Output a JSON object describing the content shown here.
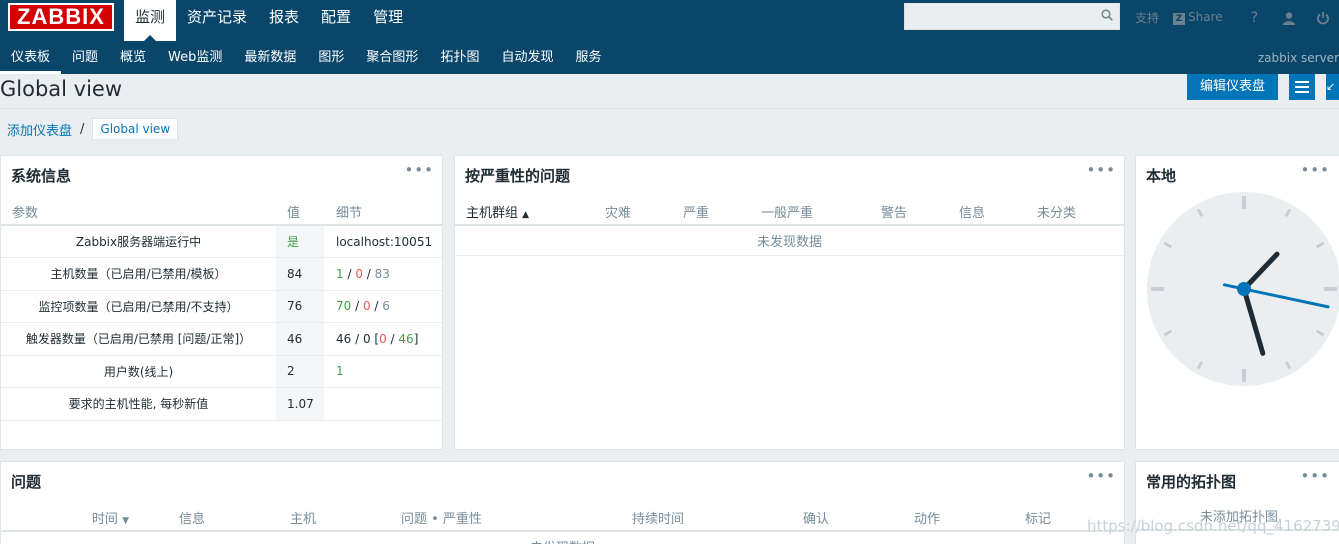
{
  "header": {
    "logo": "ZABBIX",
    "main_menu": [
      {
        "label": "监测",
        "active": true
      },
      {
        "label": "资产记录",
        "active": false
      },
      {
        "label": "报表",
        "active": false
      },
      {
        "label": "配置",
        "active": false
      },
      {
        "label": "管理",
        "active": false
      }
    ],
    "search": {
      "value": "",
      "placeholder": ""
    },
    "support_label": "支持",
    "share_label": "Share",
    "help_icon": "question-icon",
    "user_icon": "user-icon",
    "logout_icon": "power-icon"
  },
  "submenu": {
    "items": [
      {
        "label": "仪表板",
        "active": true
      },
      {
        "label": "问题",
        "active": false
      },
      {
        "label": "概览",
        "active": false
      },
      {
        "label": "Web监测",
        "active": false
      },
      {
        "label": "最新数据",
        "active": false
      },
      {
        "label": "图形",
        "active": false
      },
      {
        "label": "聚合图形",
        "active": false
      },
      {
        "label": "拓扑图",
        "active": false
      },
      {
        "label": "自动发现",
        "active": false
      },
      {
        "label": "服务",
        "active": false
      }
    ],
    "server_name": "zabbix server"
  },
  "page": {
    "title": "Global view",
    "edit_button": "编辑仪表盘",
    "menu_icon": "hamburger-icon",
    "fullscreen_icon": "fullscreen-icon"
  },
  "breadcrumbs": {
    "add_dashboard": "添加仪表盘",
    "separator": "/",
    "current": "Global view"
  },
  "system_info": {
    "title": "系统信息",
    "columns": [
      "参数",
      "值",
      "细节"
    ],
    "rows": [
      {
        "param": "Zabbix服务器端运行中",
        "value": "是",
        "details": "localhost:10051"
      },
      {
        "param": "主机数量（已启用/已禁用/模板）",
        "value": "84",
        "d1": "1",
        "d2": "0",
        "d3": "83"
      },
      {
        "param": "监控项数量（已启用/已禁用/不支持）",
        "value": "76",
        "d1": "70",
        "d2": "0",
        "d3": "6"
      },
      {
        "param": "触发器数量（已启用/已禁用 [问题/正常]）",
        "value": "46",
        "d1": "46",
        "d2": "0",
        "d3": "0",
        "d4": "46"
      },
      {
        "param": "用户数(线上)",
        "value": "2",
        "d1": "1"
      },
      {
        "param": "要求的主机性能, 每秒新值",
        "value": "1.07"
      }
    ]
  },
  "problems_by_severity": {
    "title": "按严重性的问题",
    "columns": [
      "主机群组",
      "灾难",
      "严重",
      "一般严重",
      "警告",
      "信息",
      "未分类"
    ],
    "no_data": "未发现数据"
  },
  "clock": {
    "title": "本地",
    "hour": 1,
    "minute": 27,
    "second": 17
  },
  "problems": {
    "title": "问题",
    "columns": [
      "时间",
      "信息",
      "主机",
      "问题 • 严重性",
      "持续时间",
      "确认",
      "动作",
      "标记"
    ],
    "no_data": "未发现数据"
  },
  "favorite_maps": {
    "title": "常用的拓扑图",
    "no_data": "未添加拓扑图."
  },
  "widget_menu_label": "•••",
  "watermark": "https://blog.csdn.net/qq_41627390",
  "colors": {
    "header_bg": "#0a466a",
    "accent_blue": "#0275b8",
    "logo_red": "#d40000",
    "ok_green": "#429e47",
    "problem_red": "#e45959"
  }
}
